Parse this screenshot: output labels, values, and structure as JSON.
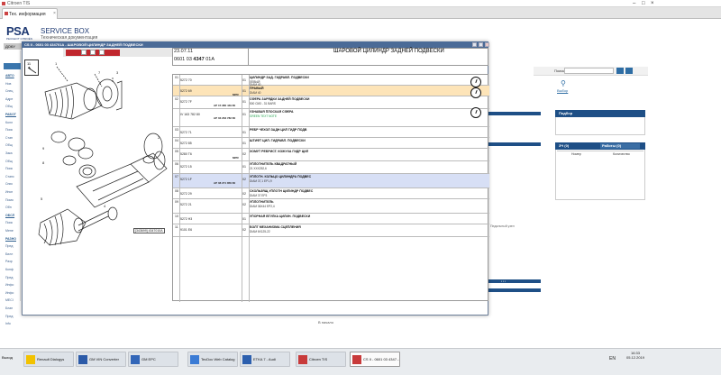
{
  "browser": {
    "title": "Citroen TIS",
    "tab": "Тех. информация"
  },
  "header": {
    "logo": "PSA",
    "logo_sub": "PEUGEOT CITROËN",
    "title": "SERVICE BOX",
    "subtitle": "Техническая документация",
    "menu": "ДОКУ"
  },
  "leftnav": {
    "items": [
      "АВТО",
      "Нов",
      "Спец",
      "Адре",
      "Общ",
      "РАБОТ",
      "Колл",
      "Поис",
      "Стан",
      "Общ",
      "Зака",
      "Общ",
      "Поис",
      "Станс",
      "Спис",
      "Инсп",
      "Помо",
      "Обп",
      "ОБСЛ",
      "Поис",
      "Мене",
      "РАЗНО",
      "Пред",
      "Билл",
      "Разр",
      "Конф",
      "Пред",
      "Инфо",
      "Инфо",
      "MECI",
      "Блан",
      "Пред",
      "Info"
    ]
  },
  "modal": {
    "title": "CS II - 0601 03 434701A - ШАРОВОЙ ЦИЛИНДР ЗАДНЕЙ ПОДВЕСКИ",
    "date": "23.07.11",
    "code_pre": "0601 03 ",
    "code_bold": "4347",
    "code_post": " 01A",
    "heading": "ШАРОВОЙ ЦИЛИНДР ЗАДНЕЙ ПОДВЕСКИ",
    "drawing_label": "[343699] 4347010A",
    "rows": [
      {
        "num": "01",
        "part": "5272 70",
        "sub": "01",
        "desc": "ЦИЛИНДР ЗАД. ГИДРАВЛ. ПОДВЕСКИ",
        "note": "ЛЕВЫЙ",
        "note2": "DIAM 40"
      },
      {
        "num": "",
        "part": "5272 69",
        "mpr": "MPR",
        "sub": "01",
        "desc": "ПРАВЫЙ",
        "note": "DIAM 40"
      },
      {
        "num": "02",
        "part": "5272 7F",
        "ref": "AP 15 380 449 80",
        "sub": "01",
        "desc": "СФЕРА ЗАРЯДКИ ЗАДНЕЙ ПОДВЕСКИ",
        "note": "500 CM3 - 31 BARS"
      },
      {
        "num": "",
        "part": "IV 163 782 80",
        "ref": "AP 03 263 782 80",
        "sub": "01",
        "desc": "УЗНАВАЯ ПЛОСКАЯ СФЕРА",
        "note": "GREEN TEXT NOTE"
      },
      {
        "num": "03",
        "part": "5272 71",
        "sub": "01",
        "desc": "РЕБР ЧЕХОЛ ЗАДН ЦИЛ ГИДР ПОДВ"
      },
      {
        "num": "04",
        "part": "5272 85",
        "sub": "01",
        "desc": "ШТИФТ ЦИЛ. ГИДРАВЛ. ПОДВЕСКИ"
      },
      {
        "num": "05",
        "part": "5280 T6",
        "mpr": "MPR",
        "sub": "02",
        "desc": "ХОМУТ РЕБРИСТ. КОЖУХА ГИДР ЦИЛ"
      },
      {
        "num": "06",
        "part": "5272 15",
        "sub": "01",
        "desc": "УПЛОТНИТЕЛЬ КВАДРАТНЫЙ",
        "note": "21 XXX252,6"
      },
      {
        "num": "07",
        "part": "5272 1F",
        "ref": "AP 08 271 856 80",
        "sub": "02",
        "desc": "УПЛОТН. КОЛЬЦО ЦИЛИНДРА ПОДВЕС",
        "note": "DIAM 37,1 EP1,9"
      },
      {
        "num": "08",
        "part": "5272 29",
        "sub": "02",
        "desc": "СКОЛЬЗЯЩ УПЛОТН ЦИЛИНДР ПОДВЕС",
        "note": "DIAM 37 EP3"
      },
      {
        "num": "09",
        "part": "5272 21",
        "sub": "02",
        "desc": "УПЛОТНИТЕЛЬ",
        "note": "DIAM 36X44 EP2,4"
      },
      {
        "num": "10",
        "part": "5272 H3",
        "sub": "01",
        "desc": "УПОРНАЯ ВТУЛКА ЦИЛИН. ПОДВЕСКИ"
      },
      {
        "num": "11",
        "part": "9101 E6",
        "sub": "02",
        "desc": "БОЛТ МЕХАНИЗМА СЦЕПЛЕНИЯ",
        "note": "DIAM 6X125-22"
      }
    ],
    "footer": "В начало"
  },
  "right": {
    "search_label": "Поиск",
    "vybor": "Выбор",
    "podbor": "Подбор",
    "spr_tab1": "ЗЧ (0)",
    "spr_tab2": "Работы (0)",
    "col1": "Номер",
    "col2": "Количество",
    "pedal": "Педальный узел"
  },
  "taskbar": {
    "start": "Выход",
    "items": [
      "Renault Dialogys",
      "GM VIN Converter",
      "GM EPC",
      "TecDoc Web Catalog",
      "ETKA 7 - Audi",
      "Citroen TIS",
      "CS II - 0601 03 4347..."
    ],
    "lang": "EN",
    "time": "16:33",
    "date": "05.12.2019"
  }
}
